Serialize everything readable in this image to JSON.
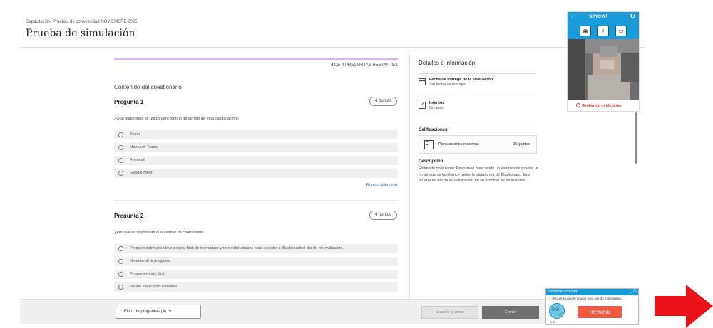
{
  "header": {
    "breadcrumb": "Capacitación: Pruebas de conectividad NOVIEMBRE 2025",
    "title": "Prueba de simulación"
  },
  "quiz": {
    "progress_fraction": 1.0,
    "remaining_count": "4",
    "remaining_label": "DE 4 PREGUNTAS RESTANTES",
    "content_heading": "Contenido del cuestionario",
    "clear_selection": "Borrar selección",
    "questions": [
      {
        "title": "Pregunta 1",
        "points": "4 puntos",
        "text": "¿Qué plataforma se utilizó para todo el desarrollo de esta capacitación?",
        "options": [
          "Zoom",
          "Microsoft Teams",
          "Anydesk",
          "Google Meet"
        ]
      },
      {
        "title": "Pregunta 2",
        "points": "4 puntos",
        "text": "¿Por qué es importante que cambie mi contraseña?",
        "options": [
          "Porque tendré una clave propia, fácil de memorizar y no tendré atrasos para acceder a Blackboard el día de mi evaluación.",
          "No entendí la pregunta",
          "Porque es más fácil.",
          "No me explicaron el motivo."
        ]
      }
    ]
  },
  "details": {
    "title": "Detalles e información",
    "due_label": "Fecha de entrega de la evaluación",
    "due_value": "Sin fecha de entrega",
    "attempts_label": "Intentos",
    "attempts_value": "Ilimitado",
    "grades_heading": "Calificaciones",
    "max_scores_label": "Puntuaciones máximas",
    "max_scores_value": "16 puntos",
    "description_heading": "Descripción",
    "description_text": "Estimado postulante: Prepárese para rendir un examen de prueba, a fin de que se familiarice mejor la plataforma de Blackboard. Esta prueba no afecta su calificación en su proceso de postulación."
  },
  "bottom_bar": {
    "filter_label": "Filtro de preguntas (4)",
    "save_label": "Guardar y cerrar",
    "send_label": "Enviar"
  },
  "smowl": {
    "logo": "smowl",
    "recording_label": "Grabando evidencias",
    "icons": [
      "webcam-icon",
      "microphone-icon",
      "screen-icon"
    ],
    "accent": "#1a9bd7"
  },
  "system_box": {
    "title": "Sistema activado",
    "controls": "_ X",
    "warning": "Recuerda que tu equipo está siendo monitoreado",
    "time": "0:11",
    "finish_label": "Terminar",
    "finish_color": "#ee5a41"
  },
  "colors": {
    "arrow": "#e8141a",
    "progress": "#d9b9e0",
    "link": "#3a6fc6"
  }
}
